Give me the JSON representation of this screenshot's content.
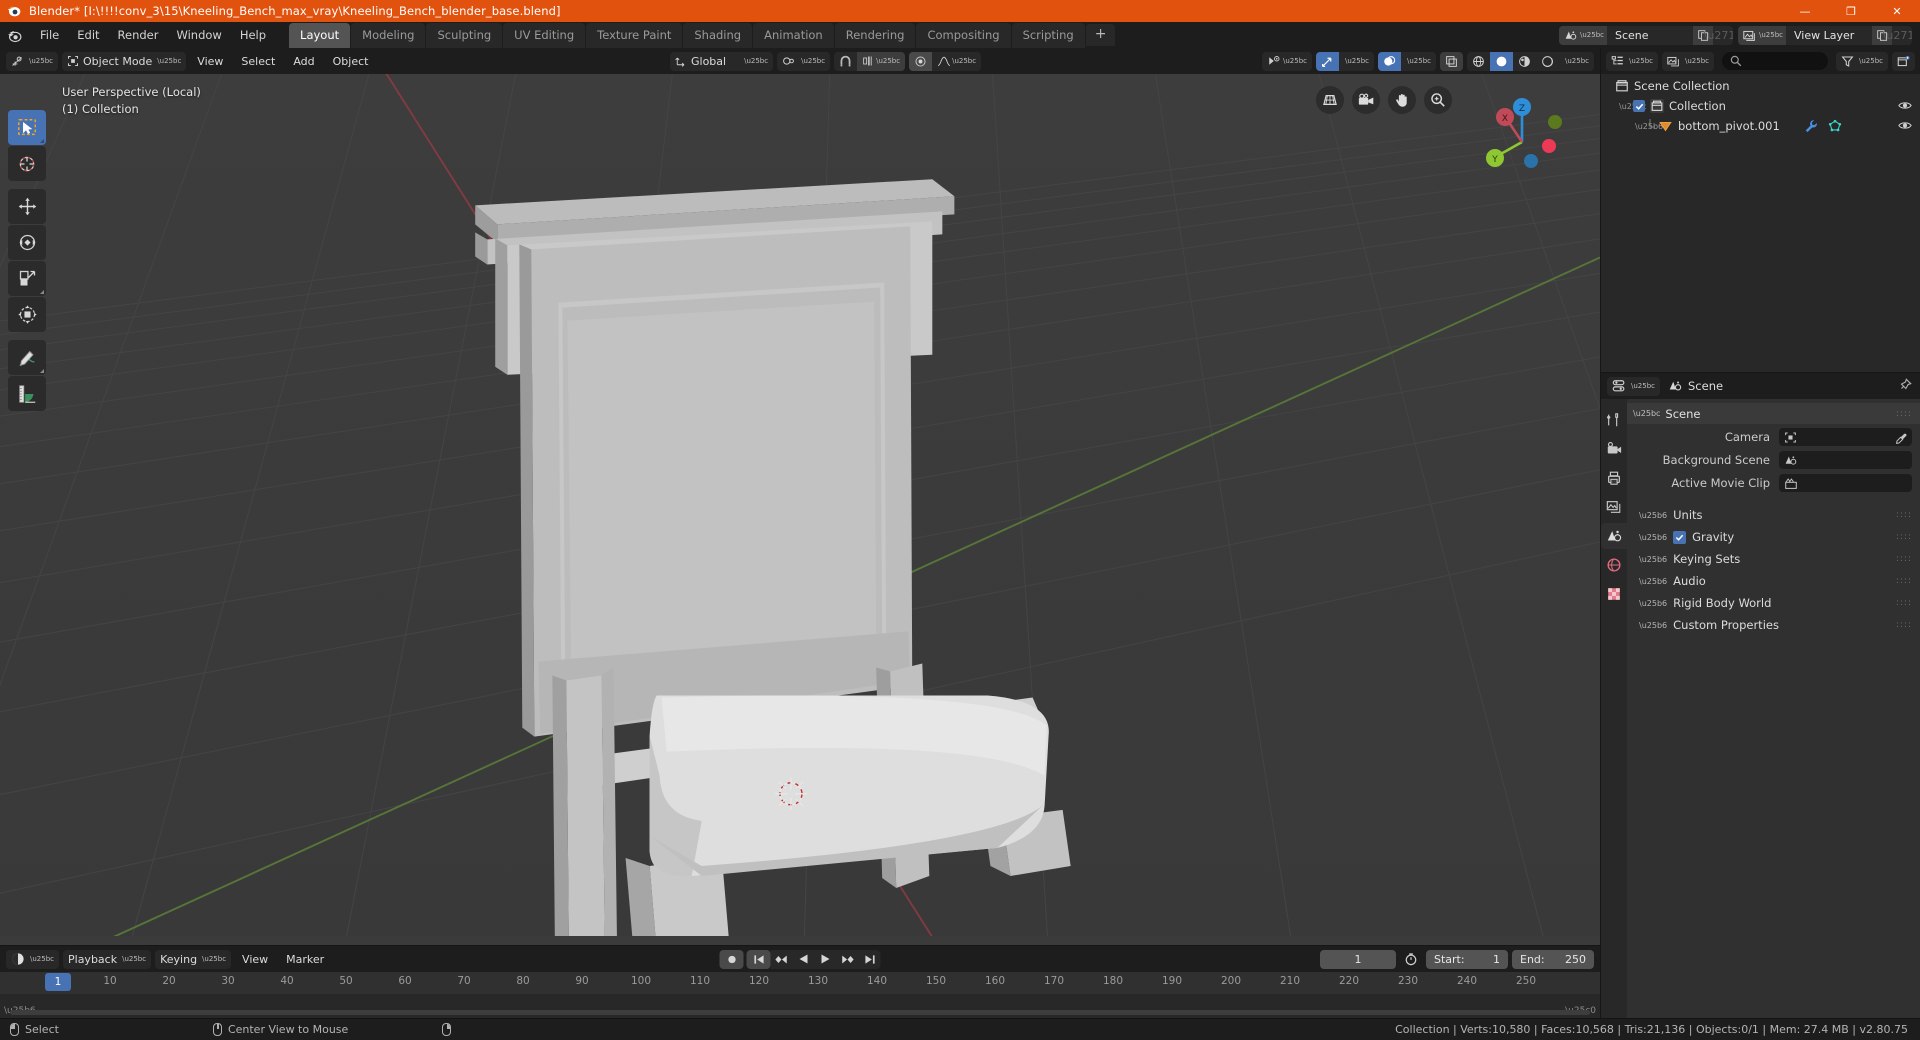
{
  "titlebar": {
    "text": "Blender* [I:\\!!!!conv_3\\15\\Kneeling_Bench_max_vray\\Kneeling_Bench_blender_base.blend]",
    "minimize": "—",
    "maximize": "❐",
    "close": "✕",
    "accent_color": "#e2520f"
  },
  "topbar": {
    "menus": [
      "File",
      "Edit",
      "Render",
      "Window",
      "Help"
    ],
    "workspaces": [
      {
        "label": "Layout",
        "active": true
      },
      {
        "label": "Modeling",
        "active": false
      },
      {
        "label": "Sculpting",
        "active": false
      },
      {
        "label": "UV Editing",
        "active": false
      },
      {
        "label": "Texture Paint",
        "active": false
      },
      {
        "label": "Shading",
        "active": false
      },
      {
        "label": "Animation",
        "active": false
      },
      {
        "label": "Rendering",
        "active": false
      },
      {
        "label": "Compositing",
        "active": false
      },
      {
        "label": "Scripting",
        "active": false
      }
    ],
    "add_workspace": "+",
    "scene_name": "Scene",
    "view_layer_name": "View Layer"
  },
  "viewport_header": {
    "editor_type": "editor-type-icon",
    "mode": "Object Mode",
    "menus": [
      "View",
      "Select",
      "Add",
      "Object"
    ],
    "transform_orientation": "Global",
    "snap_enabled": false,
    "proportional_editing": false
  },
  "viewport": {
    "perspective_label": "User Perspective (Local)",
    "collection_label": "(1) Collection",
    "gizmo_axes": [
      "X",
      "Y",
      "Z"
    ],
    "nav_buttons": [
      "grid-toggle-icon",
      "camera-view-icon",
      "pan-view-icon",
      "zoom-view-icon"
    ],
    "tools": [
      {
        "name": "tweak-select-tool",
        "active": true
      },
      {
        "name": "cursor-tool",
        "active": false
      },
      {
        "name": "move-tool",
        "active": false
      },
      {
        "name": "rotate-tool",
        "active": false
      },
      {
        "name": "scale-tool",
        "active": false
      },
      {
        "name": "transform-tool",
        "active": false
      },
      {
        "name": "annotate-tool",
        "active": false
      },
      {
        "name": "measure-tool",
        "active": false
      }
    ]
  },
  "timeline": {
    "editor_type": "timeline-icon",
    "menus": [
      "Playback",
      "Keying",
      "View",
      "Marker"
    ],
    "current_frame": "1",
    "start_label": "Start:",
    "start_value": "1",
    "end_label": "End:",
    "end_value": "250",
    "ticks": [
      "10",
      "20",
      "30",
      "40",
      "50",
      "60",
      "70",
      "80",
      "90",
      "100",
      "110",
      "120",
      "130",
      "140",
      "150",
      "160",
      "170",
      "180",
      "190",
      "200",
      "210",
      "220",
      "230",
      "240",
      "250"
    ],
    "playhead_label": "1"
  },
  "outliner": {
    "display_mode": "View Layer",
    "search_placeholder": "",
    "rows": [
      {
        "label": "Scene Collection",
        "icon": "collection-icon",
        "depth": 0,
        "has_checkbox": false,
        "has_eye": false,
        "expanded": null
      },
      {
        "label": "Collection",
        "icon": "collection-icon",
        "depth": 1,
        "has_checkbox": true,
        "has_eye": true,
        "expanded": true
      },
      {
        "label": "bottom_pivot.001",
        "icon": "mesh-object-icon",
        "depth": 2,
        "has_checkbox": false,
        "has_eye": true,
        "expanded": false,
        "extra_icons": [
          "modifier-wrench-icon",
          "mesh-data-icon"
        ]
      }
    ]
  },
  "properties": {
    "breadcrumb": "Scene",
    "tabs": [
      {
        "name": "tool-tab",
        "active": false
      },
      {
        "name": "render-tab",
        "active": false
      },
      {
        "name": "output-tab",
        "active": false
      },
      {
        "name": "view-layer-tab",
        "active": false
      },
      {
        "name": "scene-tab",
        "active": true
      },
      {
        "name": "world-tab",
        "active": false
      },
      {
        "name": "texture-tab",
        "active": false
      }
    ],
    "panel_title": "Scene",
    "fields": [
      {
        "label": "Camera",
        "value": "",
        "icon": "camera-icon",
        "has_eyedropper": true
      },
      {
        "label": "Background Scene",
        "value": "",
        "icon": "scene-icon",
        "has_eyedropper": false
      },
      {
        "label": "Active Movie Clip",
        "value": "",
        "icon": "movie-clip-icon",
        "has_eyedropper": false
      }
    ],
    "sections": [
      {
        "label": "Units",
        "checkbox": null
      },
      {
        "label": "Gravity",
        "checkbox": true
      },
      {
        "label": "Keying Sets",
        "checkbox": null
      },
      {
        "label": "Audio",
        "checkbox": null
      },
      {
        "label": "Rigid Body World",
        "checkbox": null
      },
      {
        "label": "Custom Properties",
        "checkbox": null
      }
    ]
  },
  "statusbar": {
    "left_items": [
      {
        "icon": "mouse-left-icon",
        "label": "Select"
      },
      {
        "icon": "mouse-middle-icon",
        "label": "Center View to Mouse"
      },
      {
        "icon": "mouse-right-icon",
        "label": ""
      }
    ],
    "stats": "Collection | Verts:10,580 | Faces:10,568 | Tris:21,136 | Objects:0/1 | Mem: 27.4 MB | v2.80.75"
  }
}
